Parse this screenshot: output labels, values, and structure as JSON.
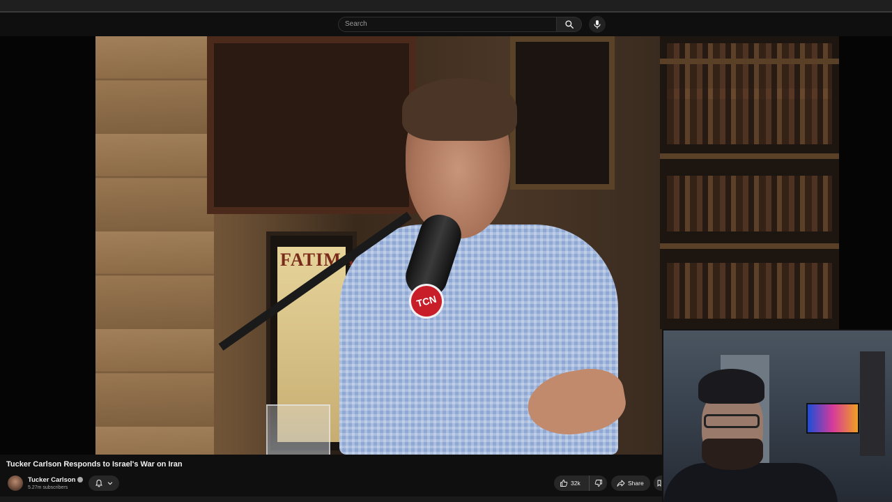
{
  "masthead": {
    "search_placeholder": "Search",
    "icons": {
      "search": "search-icon",
      "mic": "microphone-icon"
    }
  },
  "video": {
    "poster_text": "FATIMA",
    "mic_badge": "TCN",
    "title": "Tucker Carlson Responds to Israel's War on Iran"
  },
  "channel": {
    "name": "Tucker Carlson",
    "subscribers": "5.27m subscribers",
    "verified_icon": "verified-icon"
  },
  "actions": {
    "like_count": "32k",
    "share_label": "Share",
    "icons": {
      "bell": "bell-icon",
      "chevron": "chevron-down-icon",
      "like": "thumbs-up-icon",
      "dislike": "thumbs-down-icon",
      "share": "share-icon",
      "save": "save-icon"
    }
  },
  "colors": {
    "background": "#0f0f0f",
    "button": "#272727",
    "secondary_text": "#aaaaaa"
  }
}
